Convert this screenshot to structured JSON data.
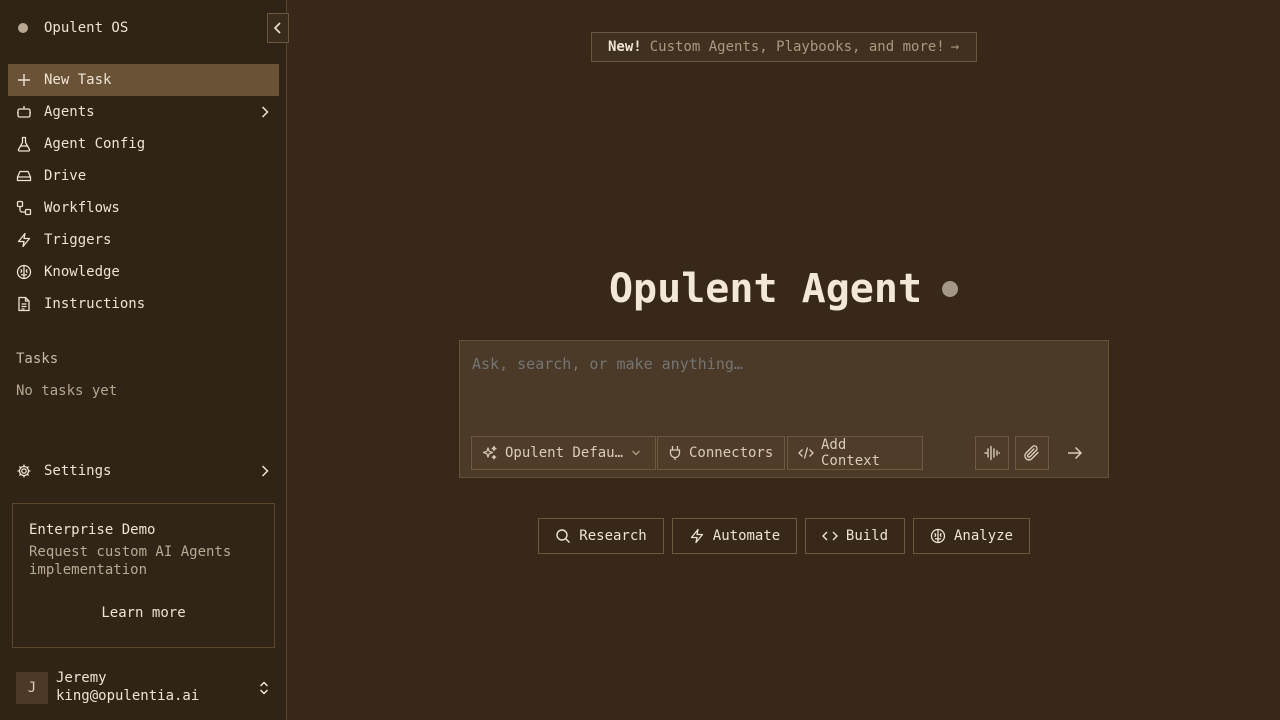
{
  "app": {
    "name": "Opulent OS"
  },
  "sidebar": {
    "items": [
      {
        "label": "New Task",
        "icon": "plus-icon"
      },
      {
        "label": "Agents",
        "icon": "bot-icon"
      },
      {
        "label": "Agent Config",
        "icon": "flask-icon"
      },
      {
        "label": "Drive",
        "icon": "hard-drive-icon"
      },
      {
        "label": "Workflows",
        "icon": "workflow-icon"
      },
      {
        "label": "Triggers",
        "icon": "lightning-icon"
      },
      {
        "label": "Knowledge",
        "icon": "brain-icon"
      },
      {
        "label": "Instructions",
        "icon": "document-icon"
      }
    ],
    "tasks_label": "Tasks",
    "tasks_empty": "No tasks yet",
    "settings_label": "Settings"
  },
  "promo": {
    "title": "Enterprise Demo",
    "description": "Request custom AI Agents implementation",
    "link": "Learn more"
  },
  "user": {
    "initial": "J",
    "name": "Jeremy",
    "email": "king@opulentia.ai"
  },
  "banner": {
    "badge": "New!",
    "text": "Custom Agents, Playbooks, and more!",
    "arrow": "→"
  },
  "hero": {
    "title": "Opulent Agent"
  },
  "composer": {
    "placeholder": "Ask, search, or make anything…",
    "model_label": "Opulent Defau…",
    "connectors_label": "Connectors",
    "context_label": "Add Context"
  },
  "actions": {
    "research": "Research",
    "automate": "Automate",
    "build": "Build",
    "analyze": "Analyze"
  },
  "colors": {
    "background": "#37281a",
    "sidebar": "#2f2416",
    "active_item": "#6a5236",
    "composer": "#4b3a27",
    "text": "#efe3d2"
  }
}
